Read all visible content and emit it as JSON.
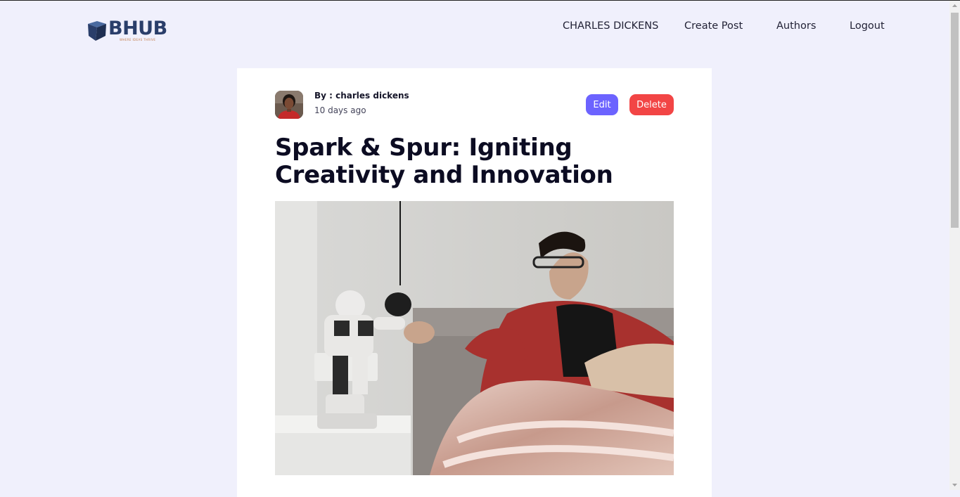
{
  "brand": {
    "name": "BHUB",
    "tagline": "WHERE IDEAS THRIVE",
    "accent": "#2a3e6a"
  },
  "nav": {
    "items": [
      {
        "label": "CHARLES DICKENS"
      },
      {
        "label": "Create Post"
      },
      {
        "label": "Authors"
      },
      {
        "label": "Logout"
      }
    ]
  },
  "post": {
    "author_line": "By : charles dickens",
    "time_ago": "10 days ago",
    "edit_label": "Edit",
    "delete_label": "Delete",
    "title": "Spark & Spur: Igniting Creativity and Innovation",
    "edit_color": "#6c63ff",
    "delete_color": "#f24545"
  },
  "colors": {
    "background": "#f0f0fc",
    "card": "#ffffff",
    "text": "#0c0c22"
  }
}
